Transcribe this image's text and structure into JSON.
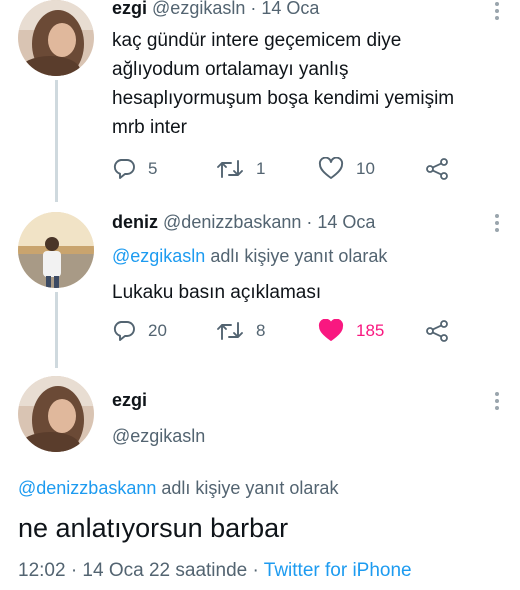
{
  "tweet1": {
    "name": "ezgi",
    "handle": "@ezgikasln",
    "time": "· 14 Oca",
    "lines": [
      "kaç gündür intere geçemicem diye",
      "ağlıyodum ortalamayı yanlış",
      "hesaplıyormuşum boşa kendimi yemişim",
      "mrb inter"
    ],
    "replies": "5",
    "retweets": "1",
    "likes": "10"
  },
  "tweet2": {
    "name": "deniz",
    "handle": "@denizzbaskann",
    "time": "· 14 Oca",
    "reply_mention": "@ezgikasln",
    "reply_suffix": " adlı kişiye yanıt olarak",
    "text": "Lukaku basın açıklaması",
    "replies": "20",
    "retweets": "8",
    "likes": "185"
  },
  "tweet3": {
    "name": "ezgi",
    "handle": "@ezgikasln",
    "reply_mention": "@denizzbaskann",
    "reply_suffix": " adlı kişiye yanıt olarak",
    "text": "ne anlatıyorsun barbar",
    "time": "12:02 · 14 Oca 22 saatinde · ",
    "source": "Twitter for iPhone"
  },
  "colors": {
    "accent": "#1d9bf0",
    "like": "#f91880",
    "muted": "#536471"
  },
  "icons": [
    "reply-icon",
    "retweet-icon",
    "like-icon",
    "share-icon",
    "more-icon"
  ]
}
